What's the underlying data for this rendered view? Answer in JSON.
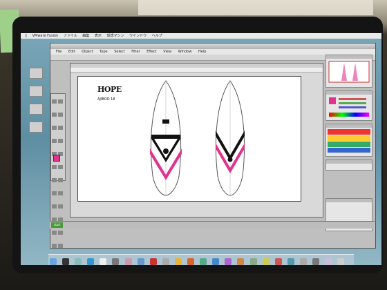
{
  "mac_menubar": {
    "items": [
      "",
      "",
      "",
      ""
    ]
  },
  "vmware": {
    "title": "VMware Fusion",
    "menu": [
      "ファイル",
      "編集",
      "表示",
      "仮想マシン",
      "ウインドウ",
      "ヘルプ"
    ]
  },
  "illustrator": {
    "menu": [
      "File",
      "Edit",
      "Object",
      "Type",
      "Select",
      "Filter",
      "Effect",
      "View",
      "Window",
      "Help"
    ],
    "document_title": ""
  },
  "artwork": {
    "logo_text": "HOPE",
    "model_text": "AJIBOO 18",
    "colors": {
      "pink": "#e0338f",
      "black": "#111111",
      "outline": "#555555"
    }
  },
  "taskbar": {
    "start_label": "start"
  },
  "colors": {
    "accent": "#e0338f"
  }
}
